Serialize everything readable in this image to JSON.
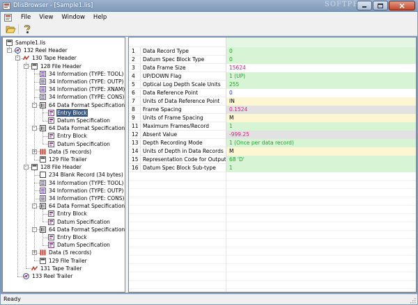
{
  "window": {
    "title": "DlisBrowser - [Sample1.lis]",
    "watermark": "SOFTPE",
    "accent": "#3b5a82"
  },
  "menu": [
    "File",
    "View",
    "Window",
    "Help"
  ],
  "toolbar": {
    "open_icon": "folder-open-icon",
    "help_icon": "help-icon"
  },
  "tree": [
    {
      "label": "Sample1.lis",
      "level": 0,
      "icon": "file",
      "expander": ""
    },
    {
      "label": "132 Reel Header",
      "level": 1,
      "icon": "reel",
      "expander": "-"
    },
    {
      "label": "130 Tape Header",
      "level": 2,
      "icon": "tape",
      "expander": "-"
    },
    {
      "label": "128 File Header",
      "level": 3,
      "icon": "file",
      "expander": "-"
    },
    {
      "label": "34 Information (TYPE: TOOL)",
      "level": 4,
      "icon": "info",
      "expander": ""
    },
    {
      "label": "34 Information (TYPE: OUTP)",
      "level": 4,
      "icon": "info",
      "expander": ""
    },
    {
      "label": "34 Information (TYPE: XNAM)",
      "level": 4,
      "icon": "info",
      "expander": ""
    },
    {
      "label": "34 Information (TYPE: CONS)",
      "level": 4,
      "icon": "info",
      "expander": ""
    },
    {
      "label": "64 Data Format Specification",
      "level": 4,
      "icon": "spec",
      "expander": "-"
    },
    {
      "label": "Entry Block",
      "level": 5,
      "icon": "block",
      "expander": "",
      "selected": true
    },
    {
      "label": "Datum Specification",
      "level": 5,
      "icon": "block",
      "expander": ""
    },
    {
      "label": "64 Data Format Specification",
      "level": 4,
      "icon": "spec",
      "expander": "-"
    },
    {
      "label": "Entry Block",
      "level": 5,
      "icon": "block",
      "expander": ""
    },
    {
      "label": "Datum Specification",
      "level": 5,
      "icon": "block",
      "expander": ""
    },
    {
      "label": "Data (5 records)",
      "level": 4,
      "icon": "data",
      "expander": "+"
    },
    {
      "label": "129 File Trailer",
      "level": 4,
      "icon": "file",
      "expander": ""
    },
    {
      "label": "128 File Header",
      "level": 3,
      "icon": "file",
      "expander": "-"
    },
    {
      "label": "234 Blank Record (34 bytes)",
      "level": 4,
      "icon": "blank",
      "expander": ""
    },
    {
      "label": "34 Information (TYPE: TOOL)",
      "level": 4,
      "icon": "info",
      "expander": ""
    },
    {
      "label": "34 Information (TYPE: OUTP)",
      "level": 4,
      "icon": "info",
      "expander": ""
    },
    {
      "label": "34 Information (TYPE: CONS)",
      "level": 4,
      "icon": "info",
      "expander": ""
    },
    {
      "label": "64 Data Format Specification",
      "level": 4,
      "icon": "spec",
      "expander": "-"
    },
    {
      "label": "Entry Block",
      "level": 5,
      "icon": "block",
      "expander": ""
    },
    {
      "label": "Datum Specification",
      "level": 5,
      "icon": "block",
      "expander": ""
    },
    {
      "label": "64 Data Format Specification",
      "level": 4,
      "icon": "spec",
      "expander": "-"
    },
    {
      "label": "Entry Block",
      "level": 5,
      "icon": "block",
      "expander": ""
    },
    {
      "label": "Datum Specification",
      "level": 5,
      "icon": "block",
      "expander": ""
    },
    {
      "label": "Data (5 records)",
      "level": 4,
      "icon": "data",
      "expander": "+"
    },
    {
      "label": "129 File Trailer",
      "level": 4,
      "icon": "file",
      "expander": ""
    },
    {
      "label": "131 Tape Trailer",
      "level": 3,
      "icon": "tape",
      "expander": ""
    },
    {
      "label": "133 Reel Trailer",
      "level": 2,
      "icon": "reel",
      "expander": ""
    }
  ],
  "grid": {
    "rows": [
      {
        "num": "1",
        "name": "Data Record Type",
        "value": "0",
        "kind": "green"
      },
      {
        "num": "2",
        "name": "Datum Spec Block Type",
        "value": "0",
        "kind": "green"
      },
      {
        "num": "3",
        "name": "Data Frame Size",
        "value": "15624",
        "kind": "magenta"
      },
      {
        "num": "4",
        "name": "UP/DOWN Flag",
        "value": "1 (UP)",
        "kind": "green"
      },
      {
        "num": "5",
        "name": "Optical Log Depth Scale Units",
        "value": "255",
        "kind": "green"
      },
      {
        "num": "6",
        "name": "Data Reference Point",
        "value": "0",
        "kind": "blue"
      },
      {
        "num": "7",
        "name": "Units of Data Reference Point",
        "value": "IN",
        "kind": "yellow"
      },
      {
        "num": "8",
        "name": "Frame Spacing",
        "value": "0.1524",
        "kind": "gray"
      },
      {
        "num": "9",
        "name": "Units of Frame Spacing",
        "value": "M",
        "kind": "yellow"
      },
      {
        "num": "11",
        "name": "Maximum Frames/Record",
        "value": "1",
        "kind": "green"
      },
      {
        "num": "12",
        "name": "Absent Value",
        "value": "-999.25",
        "kind": "gray"
      },
      {
        "num": "13",
        "name": "Depth Recording Mode",
        "value": "1 (Once per data record)",
        "kind": "green"
      },
      {
        "num": "14",
        "name": "Units of Depth in Data Records",
        "value": "M",
        "kind": "yellow"
      },
      {
        "num": "15",
        "name": "Representation Code for Output ...",
        "value": "68 'D'",
        "kind": "green"
      },
      {
        "num": "16",
        "name": "Datum Spec Block Sub-type",
        "value": "1",
        "kind": "green"
      }
    ]
  },
  "palette": {
    "green_bg": "#d7f5d5",
    "green_fg": "#23a02a",
    "yellow_bg": "#fdf6d2",
    "yellow_fg": "#000000",
    "gray_bg": "#e2e2e2",
    "gray_fg": "#d4237a",
    "magenta_fg": "#d4237a",
    "blue_fg": "#2b3fb3"
  },
  "status": {
    "text": "Ready"
  }
}
